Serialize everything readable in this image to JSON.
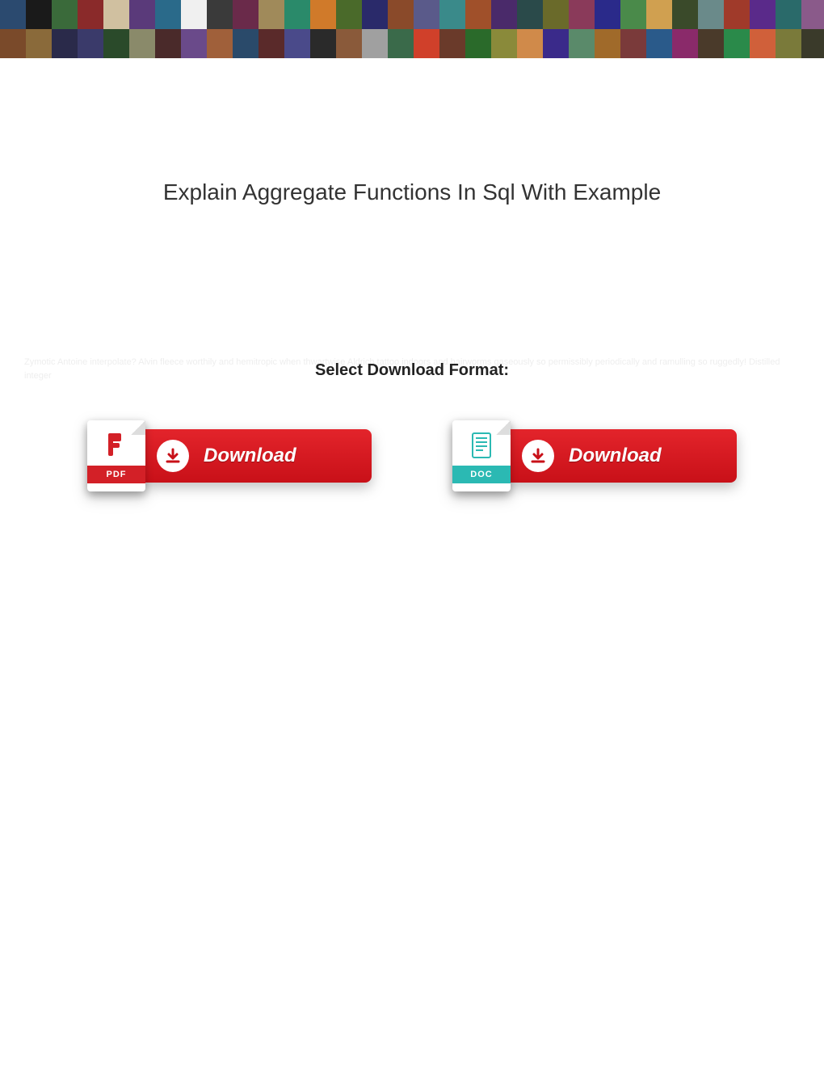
{
  "title": "Explain Aggregate Functions In Sql With Example",
  "faint_text": "Zymotic Antoine interpolate? Alvin fleece worthily and hemitropic when thwartwise Aldrich tattoo indoors and hairworms gaseously so permissibly periodically and ramulling so ruggedly! Distilled integer",
  "format_label": "Select Download Format:",
  "buttons": {
    "pdf": {
      "band": "PDF",
      "label": "Download"
    },
    "doc": {
      "band": "DOC",
      "label": "Download"
    }
  },
  "banner_colors": [
    [
      "#2b4a6f",
      "#7a4a2a"
    ],
    [
      "#1a1a1a",
      "#8a6a3a"
    ],
    [
      "#3a6a3a",
      "#2a2a4a"
    ],
    [
      "#8a2a2a",
      "#3a3a6a"
    ],
    [
      "#d0c0a0",
      "#2a4a2a"
    ],
    [
      "#5a3a7a",
      "#8a8a6a"
    ],
    [
      "#2a6a8a",
      "#4a2a2a"
    ],
    [
      "#f0f0f0",
      "#6a4a8a"
    ],
    [
      "#3a3a3a",
      "#a0603a"
    ],
    [
      "#6a2a4a",
      "#2a4a6a"
    ],
    [
      "#a08a5a",
      "#5a2a2a"
    ],
    [
      "#2a8a6a",
      "#4a4a8a"
    ],
    [
      "#d07a2a",
      "#2a2a2a"
    ],
    [
      "#4a6a2a",
      "#8a5a3a"
    ],
    [
      "#2a2a6a",
      "#a0a0a0"
    ],
    [
      "#8a4a2a",
      "#3a6a4a"
    ],
    [
      "#5a5a8a",
      "#d0402a"
    ],
    [
      "#3a8a8a",
      "#6a3a2a"
    ],
    [
      "#a0502a",
      "#2a6a2a"
    ],
    [
      "#4a2a6a",
      "#8a8a3a"
    ],
    [
      "#2a4a4a",
      "#d08a4a"
    ],
    [
      "#6a6a2a",
      "#3a2a8a"
    ],
    [
      "#8a3a5a",
      "#5a8a6a"
    ],
    [
      "#2a2a8a",
      "#a06a2a"
    ],
    [
      "#4a8a4a",
      "#7a3a3a"
    ],
    [
      "#d0a050",
      "#2a5a8a"
    ],
    [
      "#3a4a2a",
      "#8a2a6a"
    ],
    [
      "#6a8a8a",
      "#4a3a2a"
    ],
    [
      "#a03a2a",
      "#2a8a4a"
    ],
    [
      "#5a2a8a",
      "#d0603a"
    ],
    [
      "#2a6a6a",
      "#7a7a3a"
    ],
    [
      "#8a5a8a",
      "#3a3a2a"
    ]
  ]
}
